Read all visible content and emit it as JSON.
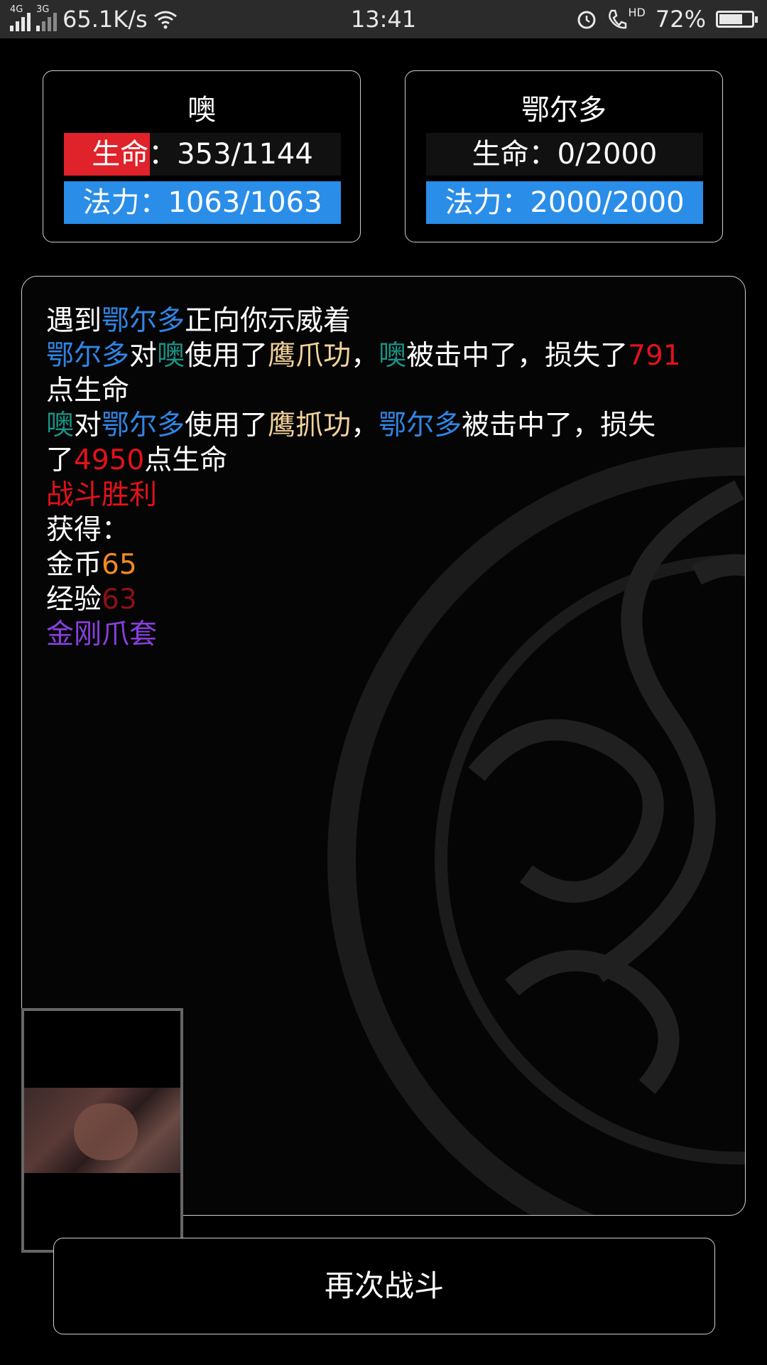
{
  "status_bar": {
    "network_1": "4G",
    "network_2": "3G",
    "speed": "65.1K/s",
    "time": "13:41",
    "hd": "HD",
    "battery": "72%",
    "battery_level": 0.72
  },
  "player": {
    "name": "噢",
    "hp_label": "生命：353/1144",
    "hp_fraction": 0.309,
    "mp_label": "法力：1063/1063",
    "mp_fraction": 1.0
  },
  "enemy": {
    "name": "鄂尔多",
    "hp_label": "生命：0/2000",
    "hp_fraction": 0.0,
    "mp_label": "法力：2000/2000",
    "mp_fraction": 1.0
  },
  "log": {
    "l1": {
      "a": "遇到",
      "b": "鄂尔多",
      "c": "正向你示威着"
    },
    "l2": {
      "a": "鄂尔多",
      "b": "对",
      "c": "噢",
      "d": "使用了",
      "e": "鹰爪功",
      "f": "，",
      "g": "噢",
      "h": "被击中了，损失了",
      "i": "791"
    },
    "l3": {
      "a": "点生命"
    },
    "l4": {
      "a": "噢",
      "b": "对",
      "c": "鄂尔多",
      "d": "使用了",
      "e": "鹰抓功",
      "f": "，",
      "g": "鄂尔多",
      "h": "被击中了，损失"
    },
    "l5": {
      "a": "了",
      "b": "4950",
      "c": "点生命"
    },
    "l6": {
      "a": "战斗胜利"
    },
    "l7": {
      "a": "获得："
    },
    "l8": {
      "a": "金币",
      "b": "65"
    },
    "l9": {
      "a": "经验",
      "b": "63"
    },
    "l10": {
      "a": "金刚爪套"
    }
  },
  "button": {
    "again_label": "再次战斗"
  },
  "colors": {
    "hp": "#e0222a",
    "mp": "#2a8de8",
    "enemy_name": "#2f86e6",
    "player_name": "#1a9486",
    "skill": "#f2d29a",
    "damage": "#e3121a",
    "gold": "#f28a22",
    "exp": "#8f1015",
    "item": "#8a3fe0"
  }
}
